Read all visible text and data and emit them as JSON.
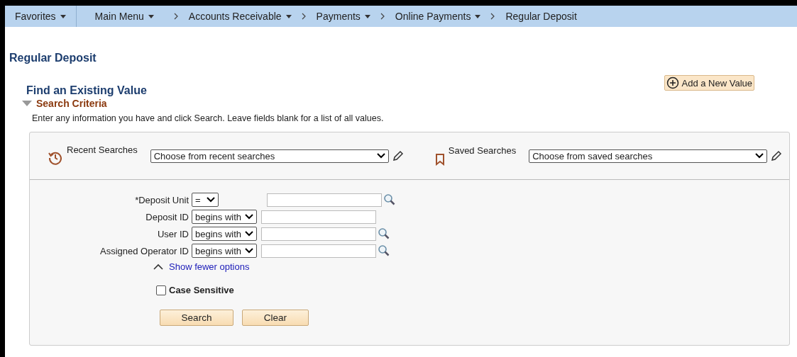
{
  "nav": [
    {
      "label": "Favorites",
      "dropdown": true
    },
    {
      "label": "Main Menu",
      "dropdown": true
    },
    {
      "label": "Accounts Receivable",
      "dropdown": true
    },
    {
      "label": "Payments",
      "dropdown": true
    },
    {
      "label": "Online Payments",
      "dropdown": true
    },
    {
      "label": "Regular Deposit",
      "dropdown": false
    }
  ],
  "page_title": "Regular Deposit",
  "add_button": "Add a New Value",
  "find_title": "Find an Existing Value",
  "section": {
    "title": "Search Criteria",
    "expanded": true
  },
  "instructions": "Enter any information you have and click Search. Leave fields blank for a list of all values.",
  "recent": {
    "label": "Recent Searches",
    "value": "Choose from recent searches"
  },
  "saved": {
    "label": "Saved Searches",
    "value": "Choose from saved searches"
  },
  "fields": [
    {
      "label": "*Deposit Unit",
      "operator": "=",
      "lookup": true
    },
    {
      "label": "Deposit ID",
      "operator": "begins with",
      "lookup": false
    },
    {
      "label": "User ID",
      "operator": "begins with",
      "lookup": true
    },
    {
      "label": "Assigned Operator ID",
      "operator": "begins with",
      "lookup": true
    }
  ],
  "toggle_link": "Show fewer options",
  "case_sensitive": {
    "label": "Case Sensitive",
    "checked": false
  },
  "buttons": [
    "Search",
    "Clear"
  ]
}
